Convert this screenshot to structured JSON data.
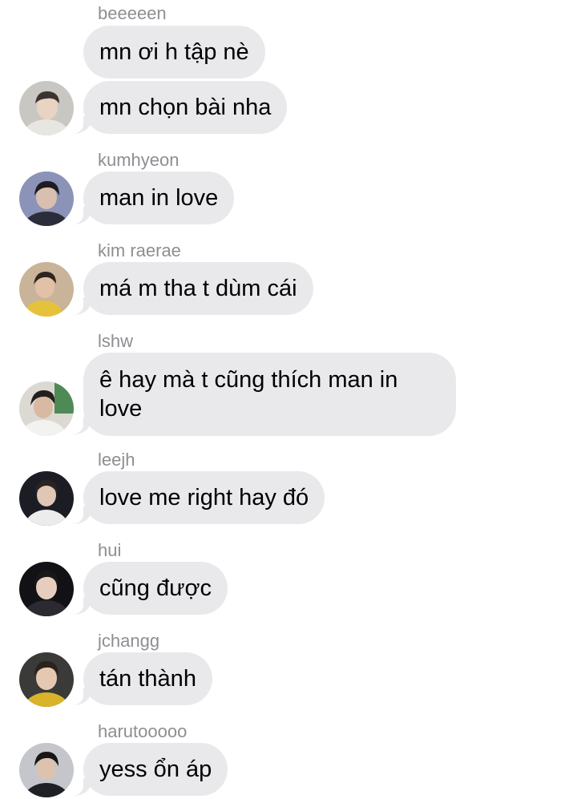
{
  "messages": [
    {
      "sender": "beeeeen",
      "texts": [
        "mn ơi h tập nè",
        "mn chọn bài nha"
      ]
    },
    {
      "sender": "kumhyeon",
      "texts": [
        "man in love"
      ]
    },
    {
      "sender": "kim raerae",
      "texts": [
        "má m tha t dùm cái"
      ]
    },
    {
      "sender": "lshw",
      "texts": [
        "ê hay mà t cũng thích man in love"
      ]
    },
    {
      "sender": "leejh",
      "texts": [
        "love me right hay đó"
      ]
    },
    {
      "sender": "hui",
      "texts": [
        "cũng được"
      ]
    },
    {
      "sender": "jchangg",
      "texts": [
        "tán thành"
      ]
    },
    {
      "sender": "harutooooo",
      "texts": [
        "yess ổn áp"
      ]
    }
  ],
  "colors": {
    "bubble": "#e9e9eb",
    "sender_text": "#8e8e93",
    "message_text": "#000000",
    "background": "#ffffff"
  }
}
